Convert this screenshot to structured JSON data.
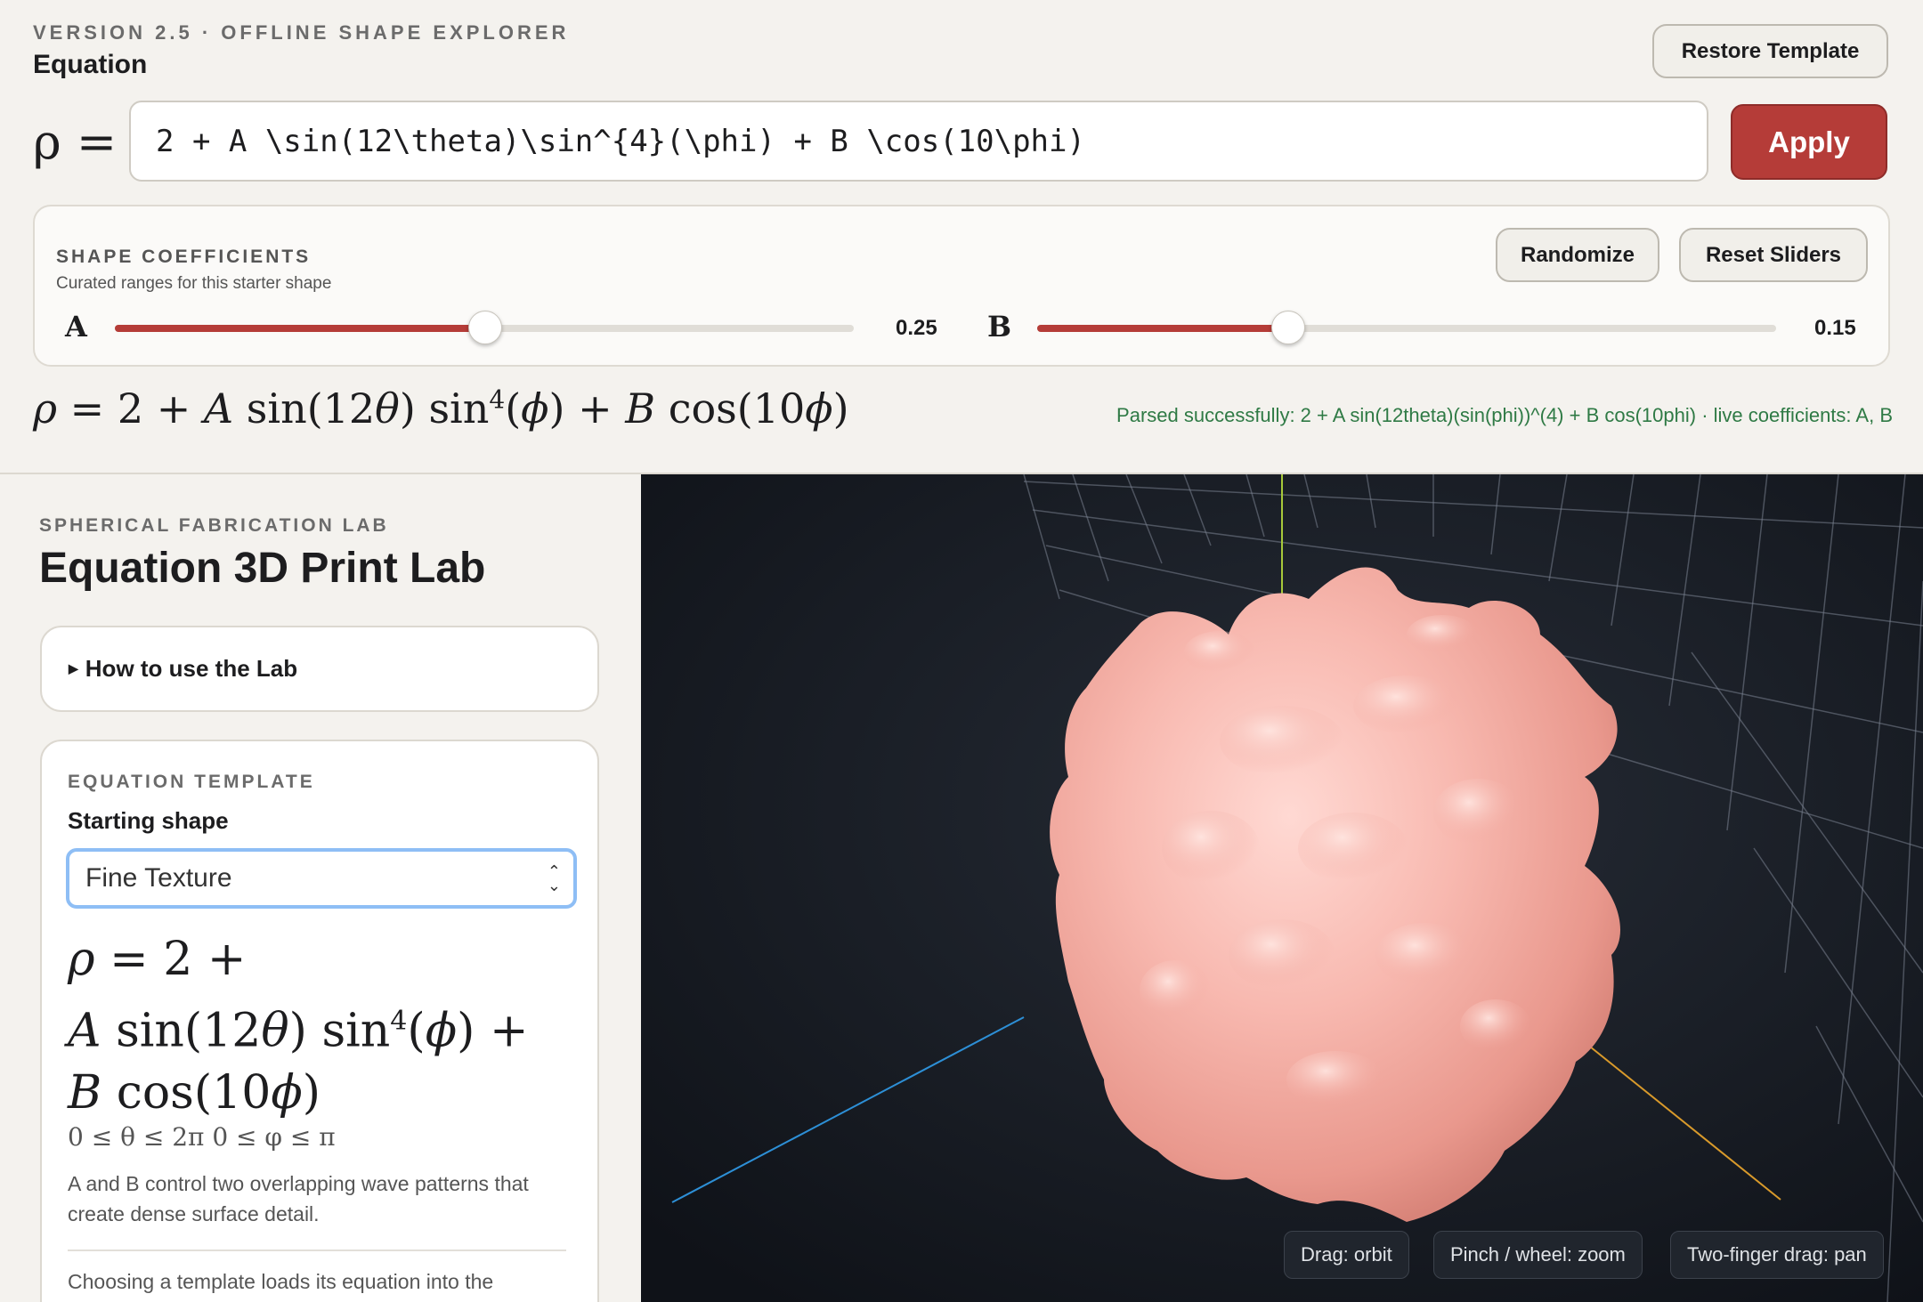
{
  "header": {
    "kicker": "VERSION 2.5 · OFFLINE SHAPE EXPLORER",
    "title": "Equation",
    "restore_label": "Restore Template"
  },
  "equation": {
    "lhs": "ρ =",
    "input_value": "2 + A \\sin(12\\theta)\\sin^{4}(\\phi) + B \\cos(10\\phi)",
    "apply_label": "Apply"
  },
  "coefficients": {
    "title": "SHAPE COEFFICIENTS",
    "subtitle": "Curated ranges for this starter shape",
    "randomize_label": "Randomize",
    "reset_label": "Reset Sliders",
    "sliders": [
      {
        "letter": "A",
        "value": "0.25",
        "fraction": 0.5
      },
      {
        "letter": "B",
        "value": "0.15",
        "fraction": 0.338
      }
    ]
  },
  "rendered": {
    "parse_status": "Parsed successfully: 2 + A sin(12theta)(sin(phi))^(4) + B cos(10phi) · live coefficients: A, B"
  },
  "sidebar": {
    "kicker": "SPHERICAL FABRICATION LAB",
    "title": "Equation 3D Print Lab",
    "howto_label": "How to use the Lab",
    "template": {
      "kicker": "EQUATION TEMPLATE",
      "label": "Starting shape",
      "selected": "Fine Texture",
      "range": "0 ≤ θ ≤ 2π 0 ≤ φ ≤ π",
      "description": "A and B control two overlapping wave patterns that create dense surface detail.",
      "note": "Choosing a template loads its equation into the"
    }
  },
  "viewport": {
    "hints": [
      "Drag: orbit",
      "Pinch / wheel: zoom",
      "Two-finger drag: pan"
    ],
    "colors": {
      "background": "#151a22",
      "shape": "#f6b3ab",
      "x_axis": "#d99a2b",
      "y_axis": "#a7c93a",
      "z_axis": "#2d8fd6"
    }
  }
}
